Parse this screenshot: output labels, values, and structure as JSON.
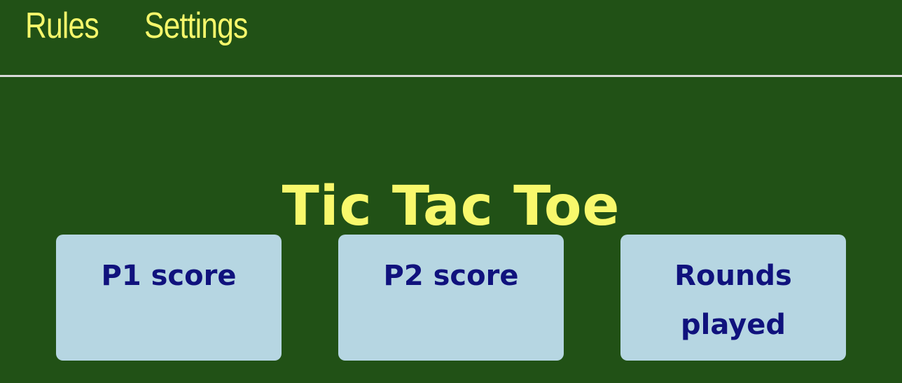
{
  "nav": {
    "items": [
      {
        "label": "Rules"
      },
      {
        "label": "Settings"
      }
    ]
  },
  "game": {
    "title": "Tic Tac Toe"
  },
  "scoreboard": {
    "cards": [
      {
        "label": "P1 score"
      },
      {
        "label": "P2 score"
      },
      {
        "label": "Rounds played"
      }
    ]
  },
  "colors": {
    "background": "#215116",
    "accent_yellow": "#f8f86c",
    "card_background": "#b6d6e2",
    "card_text": "#10127d",
    "divider": "#d9d9d9"
  }
}
